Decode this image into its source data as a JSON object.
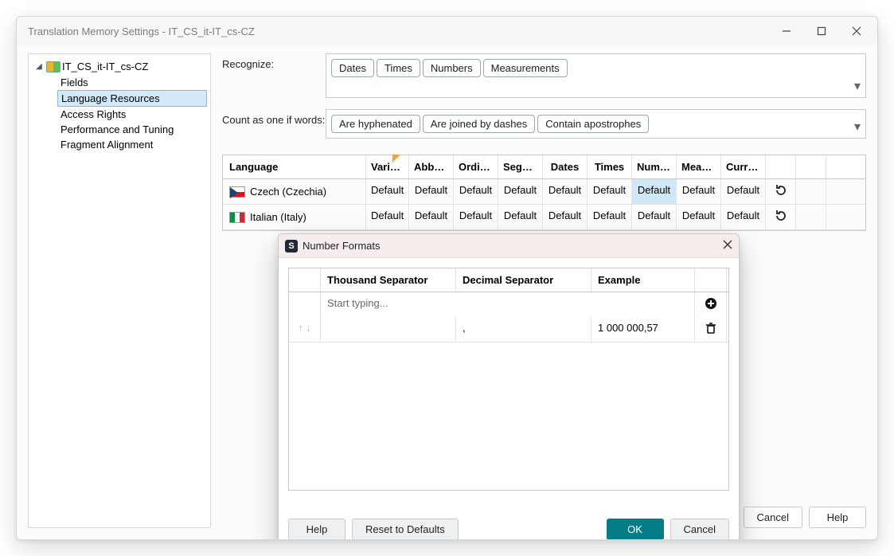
{
  "window": {
    "title": "Translation Memory Settings - IT_CS_it-IT_cs-CZ"
  },
  "tree": {
    "root": "IT_CS_it-IT_cs-CZ",
    "items": [
      "Fields",
      "Language Resources",
      "Access Rights",
      "Performance and Tuning",
      "Fragment Alignment"
    ],
    "selectedIndex": 1
  },
  "recognize": {
    "label": "Recognize:",
    "chips": [
      "Dates",
      "Times",
      "Numbers",
      "Measurements"
    ]
  },
  "countAsOne": {
    "label": "Count as one if words:",
    "chips": [
      "Are hyphenated",
      "Are joined by dashes",
      "Contain apostrophes"
    ]
  },
  "grid": {
    "headers": [
      "Language",
      "Variabl...",
      "Abbrev...",
      "Ordinal...",
      "Segme...",
      "Dates",
      "Times",
      "Numbers",
      "Measur...",
      "Currency"
    ],
    "rows": [
      {
        "lang": "Czech (Czechia)",
        "flag": "cz",
        "cells": [
          "Default",
          "Default",
          "Default",
          "Default",
          "Default",
          "Default",
          "Default",
          "Default",
          "Default"
        ],
        "hlIndex": 6
      },
      {
        "lang": "Italian (Italy)",
        "flag": "it",
        "cells": [
          "Default",
          "Default",
          "Default",
          "Default",
          "Default",
          "Default",
          "Default",
          "Default",
          "Default"
        ]
      }
    ]
  },
  "footer": {
    "cancel": "Cancel",
    "help": "Help"
  },
  "modal": {
    "title": "Number Formats",
    "headers": [
      "Thousand Separator",
      "Decimal Separator",
      "Example"
    ],
    "placeholder": "Start typing...",
    "rows": [
      {
        "thousand": "",
        "decimal": ",",
        "example": "1 000 000,57"
      }
    ],
    "buttons": {
      "help": "Help",
      "reset": "Reset to Defaults",
      "ok": "OK",
      "cancel": "Cancel"
    }
  }
}
